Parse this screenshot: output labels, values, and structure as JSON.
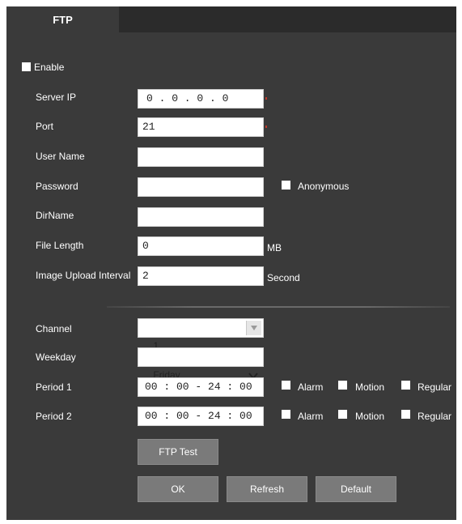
{
  "tab": {
    "label": "FTP"
  },
  "enable_label": "Enable",
  "fields": {
    "server_ip": {
      "label": "Server IP",
      "value": "0 . 0 . 0 . 0"
    },
    "port": {
      "label": "Port",
      "value": "21"
    },
    "user_name": {
      "label": "User Name",
      "value": ""
    },
    "password": {
      "label": "Password",
      "value": ""
    },
    "anonymous_label": "Anonymous",
    "dirname": {
      "label": "DirName",
      "value": ""
    },
    "file_length": {
      "label": "File Length",
      "value": "0",
      "unit": "MB"
    },
    "image_upload_interval": {
      "label": "Image Upload Interval",
      "value": "2",
      "unit": "Second"
    }
  },
  "schedule": {
    "channel": {
      "label": "Channel",
      "value": "1"
    },
    "weekday": {
      "label": "Weekday",
      "value": "Friday"
    },
    "period1": {
      "label": "Period 1",
      "value": "00 : 00 - 24 : 00"
    },
    "period2": {
      "label": "Period 2",
      "value": "00 : 00 - 24 : 00"
    },
    "alarm_label": "Alarm",
    "motion_label": "Motion",
    "regular_label": "Regular"
  },
  "buttons": {
    "ftp_test": "FTP Test",
    "ok": "OK",
    "refresh": "Refresh",
    "default": "Default"
  },
  "colors": {
    "panel": "#3a3a3a",
    "tabbar": "#2b2b2b",
    "button": "#7a7a7a"
  }
}
